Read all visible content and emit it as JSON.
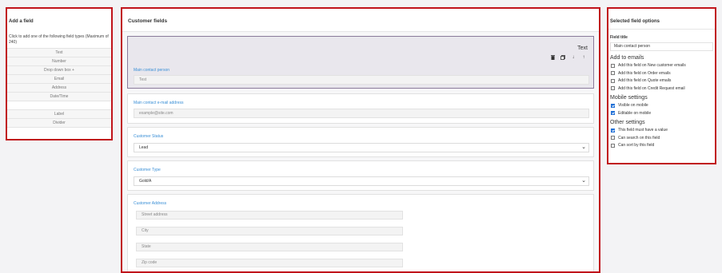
{
  "left": {
    "title": "Add a field",
    "description": "Click to add one of the following field types (Maximum of 240)",
    "types": [
      "Text",
      "Number",
      "Drop down box +",
      "Email",
      "Address",
      "Date/Time",
      "",
      "Label",
      "Divider",
      ""
    ]
  },
  "center": {
    "title": "Customer fields",
    "selected_type": "Text",
    "fields": [
      {
        "label": "Main contact person",
        "placeholder": "Test"
      },
      {
        "label": "Main contact e-mail address",
        "placeholder": "example@site.com"
      },
      {
        "label": "Customer Status",
        "value": "Lead"
      },
      {
        "label": "Customer Type",
        "value": "Gold/A"
      },
      {
        "label": "Customer Address",
        "address": [
          "Street address",
          "City",
          "State",
          "Zip code"
        ]
      }
    ]
  },
  "right": {
    "title": "Selected field options",
    "field_title_label": "Field title",
    "field_title_value": "Main contact person",
    "emails_heading": "Add to emails",
    "emails": [
      {
        "label": "Add this field on New customer emails",
        "checked": false
      },
      {
        "label": "Add this field on Order emails",
        "checked": false
      },
      {
        "label": "Add this field on Quote emails",
        "checked": false
      },
      {
        "label": "Add this field on Credit Request email",
        "checked": false
      }
    ],
    "mobile_heading": "Mobile settings",
    "mobile": [
      {
        "label": "Visible on mobile",
        "checked": true
      },
      {
        "label": "Editable on mobile",
        "checked": true
      }
    ],
    "other_heading": "Other settings",
    "other": [
      {
        "label": "This field must have a value",
        "checked": true
      },
      {
        "label": "Can search on this field",
        "checked": false
      },
      {
        "label": "Can sort by this field",
        "checked": false
      }
    ]
  }
}
